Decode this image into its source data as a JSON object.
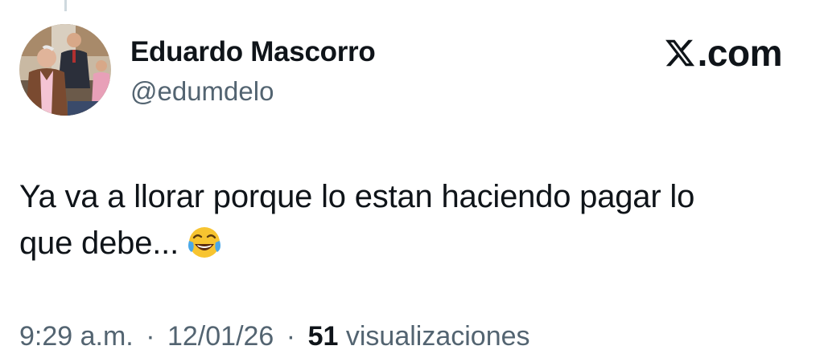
{
  "tweet": {
    "author": {
      "display_name": "Eduardo Mascorro",
      "handle": "@edumdelo",
      "avatar_icon": "profile-photo"
    },
    "brand": {
      "icon": "x-logo-icon",
      "label": ".com"
    },
    "text_line_1": "Ya va a llorar porque lo estan haciendo pagar lo",
    "text_line_2": "que debe...",
    "emoji": "face-with-tears-of-joy",
    "time": "9:29 a.m.",
    "date": "12/01/26",
    "separator": "·",
    "views_count": "51",
    "views_label": "visualizaciones"
  },
  "colors": {
    "text_primary": "#0f1419",
    "text_secondary": "#536471",
    "thread_line": "#cfd9de"
  }
}
